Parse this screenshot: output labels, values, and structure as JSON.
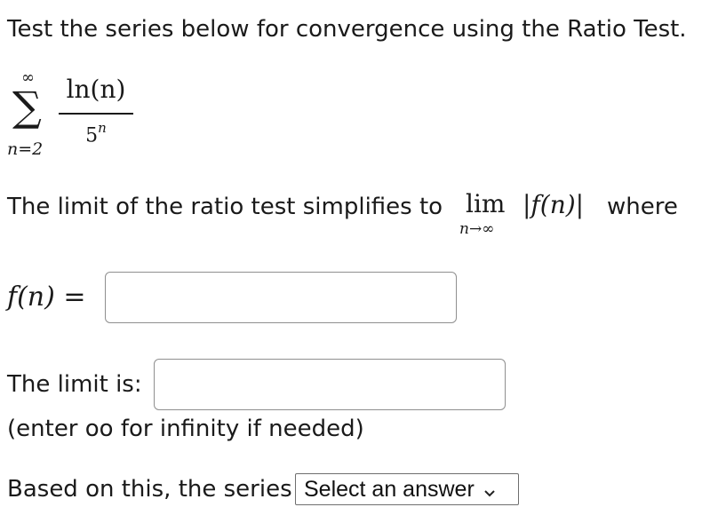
{
  "question": {
    "intro": "Test the series below for convergence using the Ratio Test."
  },
  "series": {
    "sigma": "∑",
    "upper_limit": "∞",
    "lower_limit": "n=2",
    "numerator": "ln(n)",
    "denominator_base": "5",
    "denominator_exponent": "n"
  },
  "ratio_test": {
    "text_before": "The limit of the ratio test simplifies to",
    "lim_word": "lim",
    "lim_subscript": "n→∞",
    "abs_expression": "|f(n)|",
    "text_after": "where"
  },
  "fn_field": {
    "label": "f(n) =",
    "value": "",
    "placeholder": ""
  },
  "limit_field": {
    "label": "The limit is:",
    "value": "",
    "placeholder": "",
    "hint": "(enter oo for infinity if needed)"
  },
  "conclusion": {
    "label": "Based on this, the series",
    "select_value": "Select an answer"
  },
  "icons": {
    "select_arrow": "chevron-down-icon"
  }
}
